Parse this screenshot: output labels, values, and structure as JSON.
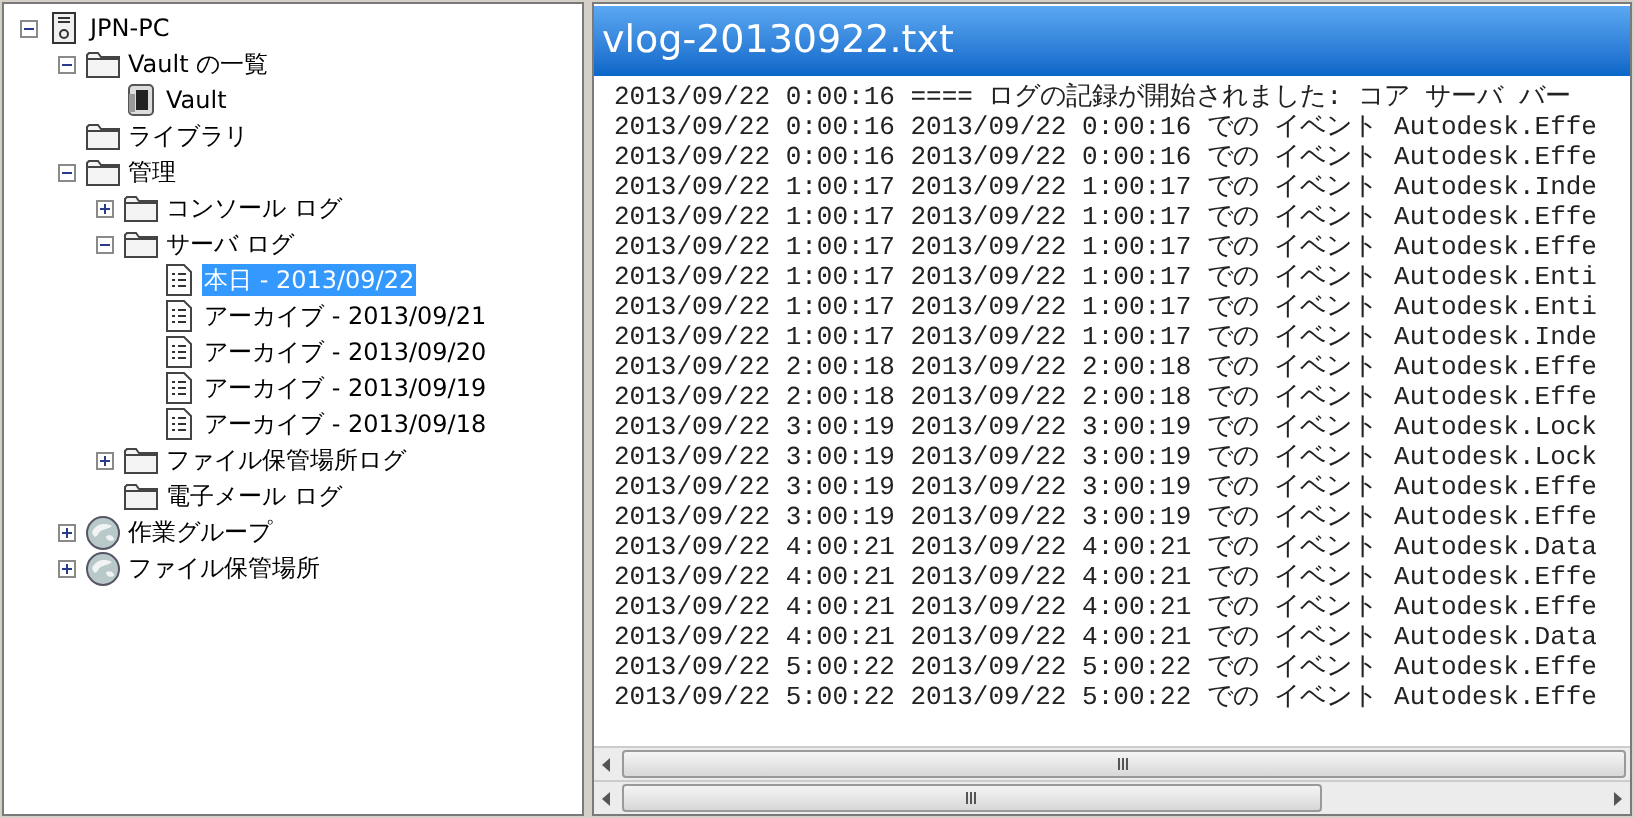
{
  "tree": [
    {
      "label": "JPN-PC",
      "kind": "computer",
      "expanded": true,
      "selected": false,
      "children": [
        {
          "label": "Vault の一覧",
          "kind": "folder",
          "expanded": true,
          "selected": false,
          "children": [
            {
              "label": "Vault",
              "kind": "vault",
              "selected": false
            }
          ]
        },
        {
          "label": "ライブラリ",
          "kind": "folder",
          "selected": false
        },
        {
          "label": "管理",
          "kind": "folder",
          "expanded": true,
          "selected": false,
          "children": [
            {
              "label": "コンソール ログ",
              "kind": "folder",
              "expanded": false,
              "selected": false
            },
            {
              "label": "サーバ ログ",
              "kind": "folder",
              "expanded": true,
              "selected": false,
              "children": [
                {
                  "label": "本日 - 2013/09/22",
                  "kind": "document",
                  "selected": true
                },
                {
                  "label": "アーカイブ - 2013/09/21",
                  "kind": "document",
                  "selected": false
                },
                {
                  "label": "アーカイブ - 2013/09/20",
                  "kind": "document",
                  "selected": false
                },
                {
                  "label": "アーカイブ - 2013/09/19",
                  "kind": "document",
                  "selected": false
                },
                {
                  "label": "アーカイブ - 2013/09/18",
                  "kind": "document",
                  "selected": false
                }
              ]
            },
            {
              "label": "ファイル保管場所ログ",
              "kind": "folder",
              "expanded": false,
              "selected": false
            },
            {
              "label": "電子メール ログ",
              "kind": "folder",
              "selected": false
            }
          ]
        },
        {
          "label": "作業グループ",
          "kind": "globe",
          "expanded": false,
          "selected": false
        },
        {
          "label": "ファイル保管場所",
          "kind": "globe",
          "expanded": false,
          "selected": false
        }
      ]
    }
  ],
  "viewer": {
    "title": "vlog-20130922.txt",
    "lines": [
      "2013/09/22 0:00:16 ==== ログの記録が開始されました: コア サーバ バー",
      "2013/09/22 0:00:16 2013/09/22 0:00:16 での イベント Autodesk.Effe",
      "2013/09/22 0:00:16 2013/09/22 0:00:16 での イベント Autodesk.Effe",
      "2013/09/22 1:00:17 2013/09/22 1:00:17 での イベント Autodesk.Inde",
      "2013/09/22 1:00:17 2013/09/22 1:00:17 での イベント Autodesk.Effe",
      "2013/09/22 1:00:17 2013/09/22 1:00:17 での イベント Autodesk.Effe",
      "2013/09/22 1:00:17 2013/09/22 1:00:17 での イベント Autodesk.Enti",
      "2013/09/22 1:00:17 2013/09/22 1:00:17 での イベント Autodesk.Enti",
      "2013/09/22 1:00:17 2013/09/22 1:00:17 での イベント Autodesk.Inde",
      "2013/09/22 2:00:18 2013/09/22 2:00:18 での イベント Autodesk.Effe",
      "2013/09/22 2:00:18 2013/09/22 2:00:18 での イベント Autodesk.Effe",
      "2013/09/22 3:00:19 2013/09/22 3:00:19 での イベント Autodesk.Lock",
      "2013/09/22 3:00:19 2013/09/22 3:00:19 での イベント Autodesk.Lock",
      "2013/09/22 3:00:19 2013/09/22 3:00:19 での イベント Autodesk.Effe",
      "2013/09/22 3:00:19 2013/09/22 3:00:19 での イベント Autodesk.Effe",
      "2013/09/22 4:00:21 2013/09/22 4:00:21 での イベント Autodesk.Data",
      "2013/09/22 4:00:21 2013/09/22 4:00:21 での イベント Autodesk.Effe",
      "2013/09/22 4:00:21 2013/09/22 4:00:21 での イベント Autodesk.Effe",
      "2013/09/22 4:00:21 2013/09/22 4:00:21 での イベント Autodesk.Data",
      "2013/09/22 5:00:22 2013/09/22 5:00:22 での イベント Autodesk.Effe",
      "2013/09/22 5:00:22 2013/09/22 5:00:22 での イベント Autodesk.Effe"
    ]
  }
}
